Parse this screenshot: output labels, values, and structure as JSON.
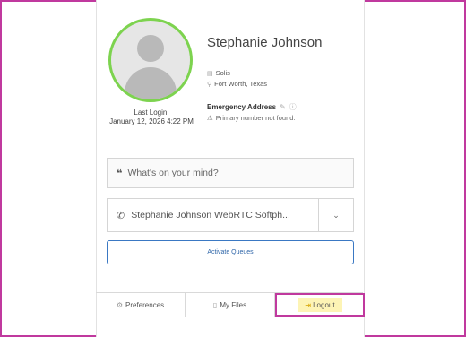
{
  "profile": {
    "name": "Stephanie Johnson",
    "last_login_label": "Last Login:",
    "last_login_value": "January 12, 2026 4:22 PM",
    "company": "Solis",
    "location": "Fort Worth, Texas",
    "emergency_label": "Emergency Address",
    "emergency_warning": "Primary number not found."
  },
  "status_input": {
    "placeholder": "What's on your mind?"
  },
  "phone": {
    "device": "Stephanie Johnson WebRTC Softph..."
  },
  "buttons": {
    "activate_queues": "Activate Queues"
  },
  "footer": {
    "preferences": "Preferences",
    "my_files": "My Files",
    "logout": "Logout"
  },
  "colors": {
    "avatar_ring": "#7dd34f",
    "highlight_border": "#c0399e",
    "logout_bg": "#fdf4b5",
    "queues_border": "#3a78c3"
  },
  "icons": {
    "company": "building-icon",
    "location": "map-pin-icon",
    "edit": "pencil-icon",
    "help": "help-circle-icon",
    "warning": "warning-icon",
    "quote": "quote-icon",
    "phone": "phone-icon",
    "dropdown": "chevron-down-icon",
    "preferences": "gear-icon",
    "files": "file-icon",
    "logout": "logout-icon"
  }
}
